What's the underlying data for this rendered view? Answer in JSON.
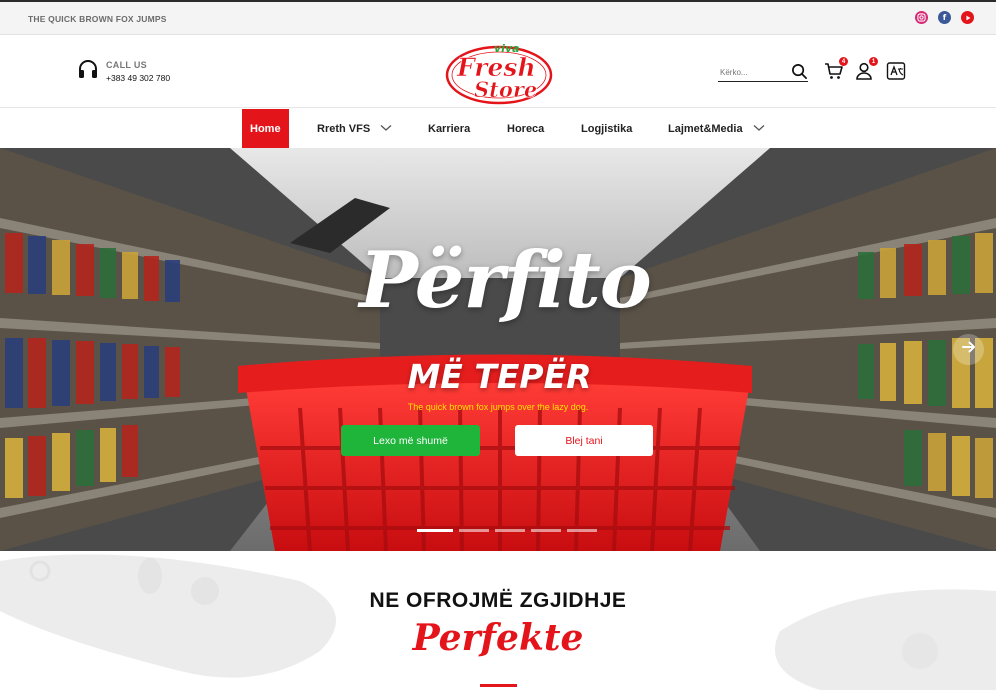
{
  "topbar": {
    "tagline": "THE QUICK BROWN FOX JUMPS",
    "socials": [
      {
        "name": "instagram",
        "color": "#d62976"
      },
      {
        "name": "facebook",
        "color": "#3b5998"
      },
      {
        "name": "youtube",
        "color": "#e4141b"
      }
    ]
  },
  "header": {
    "call_title": "CALL US",
    "call_number": "+383 49 302 780",
    "logo": {
      "viva": "viva",
      "fresh": "Fresh",
      "store": "Store"
    },
    "search_placeholder": "Kërko...",
    "cart_count": "4",
    "user_count": "1",
    "icons": [
      "headphones-icon",
      "search-icon",
      "cart-icon",
      "user-icon",
      "translate-icon"
    ]
  },
  "nav": {
    "items": [
      {
        "label": "Home",
        "active": true
      },
      {
        "label": "Rreth VFS",
        "dropdown": true
      },
      {
        "label": "Karriera"
      },
      {
        "label": "Horeca"
      },
      {
        "label": "Logjistika"
      },
      {
        "label": "Lajmet&Media",
        "dropdown": true
      }
    ]
  },
  "hero": {
    "title": "Përfito",
    "subtitle": "MË TEPËR",
    "tagline": "The quick brown fox jumps over the lazy dog.",
    "primary_button": "Lexo më shumë",
    "secondary_button": "Blej tani",
    "slides_total": 5,
    "slide_active": 1
  },
  "section": {
    "title": "NE OFROJMË ZGJIDHJE",
    "script": "Perfekte"
  },
  "colors": {
    "brand_red": "#e4141b",
    "green": "#1fb53b",
    "yellow": "#ffe100"
  }
}
